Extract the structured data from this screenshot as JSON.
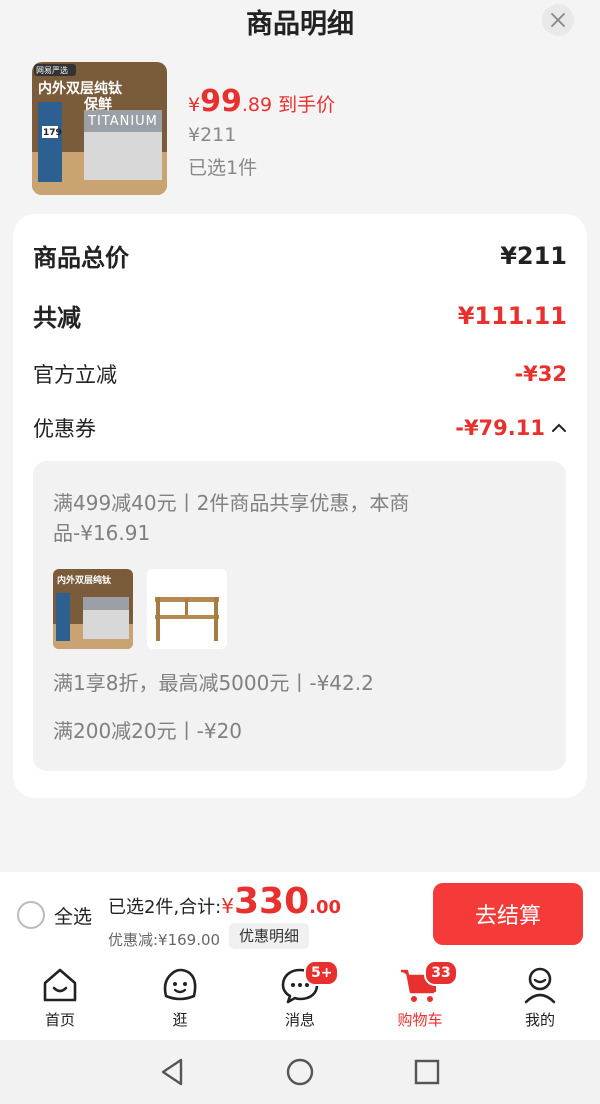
{
  "sheet": {
    "title": "商品明细",
    "product": {
      "price_yen": "¥",
      "price_int": "99",
      "price_dec": ".89",
      "price_tag": "到手价",
      "original_price": "¥211",
      "selected": "已选1件",
      "thumb_text_top": "内外双层纯钛",
      "thumb_text_second": "保鲜",
      "thumb_brand": "TITANIUM",
      "thumb_badge": "网易严选",
      "thumb_price": "179"
    }
  },
  "summary": {
    "total_label": "商品总价",
    "total_value": "¥211",
    "reduce_label": "共减",
    "reduce_value": "¥111.11",
    "official_label": "官方立减",
    "official_value": "-¥32",
    "coupon_label": "优惠券",
    "coupon_value": "-¥79.11",
    "coupon_icon": "chevron-up-icon",
    "coupon_details": {
      "line1": "满499减40元丨2件商品共享优惠，本商",
      "line2": "品-¥16.91",
      "line3": "满1享8折，最高减5000元丨-¥42.2",
      "line4": "满200减20元丨-¥20"
    }
  },
  "footer": {
    "select_all": "全选",
    "selected_prefix": "已选2件,合计:",
    "sum_yen": "¥",
    "sum_int": "330",
    "sum_dec": ".00",
    "discount": "优惠减:¥169.00",
    "detail_button": "优惠明细",
    "checkout": "去结算"
  },
  "tabs": [
    {
      "label": "首页",
      "icon": "home-icon"
    },
    {
      "label": "逛",
      "icon": "browse-icon"
    },
    {
      "label": "消息",
      "icon": "message-icon",
      "badge": "5+"
    },
    {
      "label": "购物车",
      "icon": "cart-icon",
      "badge": "33",
      "active": true
    },
    {
      "label": "我的",
      "icon": "profile-icon"
    }
  ],
  "colors": {
    "accent": "#e8302f",
    "checkout_bg": "#f53a3a",
    "sheet_bg": "#f4f4f4"
  }
}
